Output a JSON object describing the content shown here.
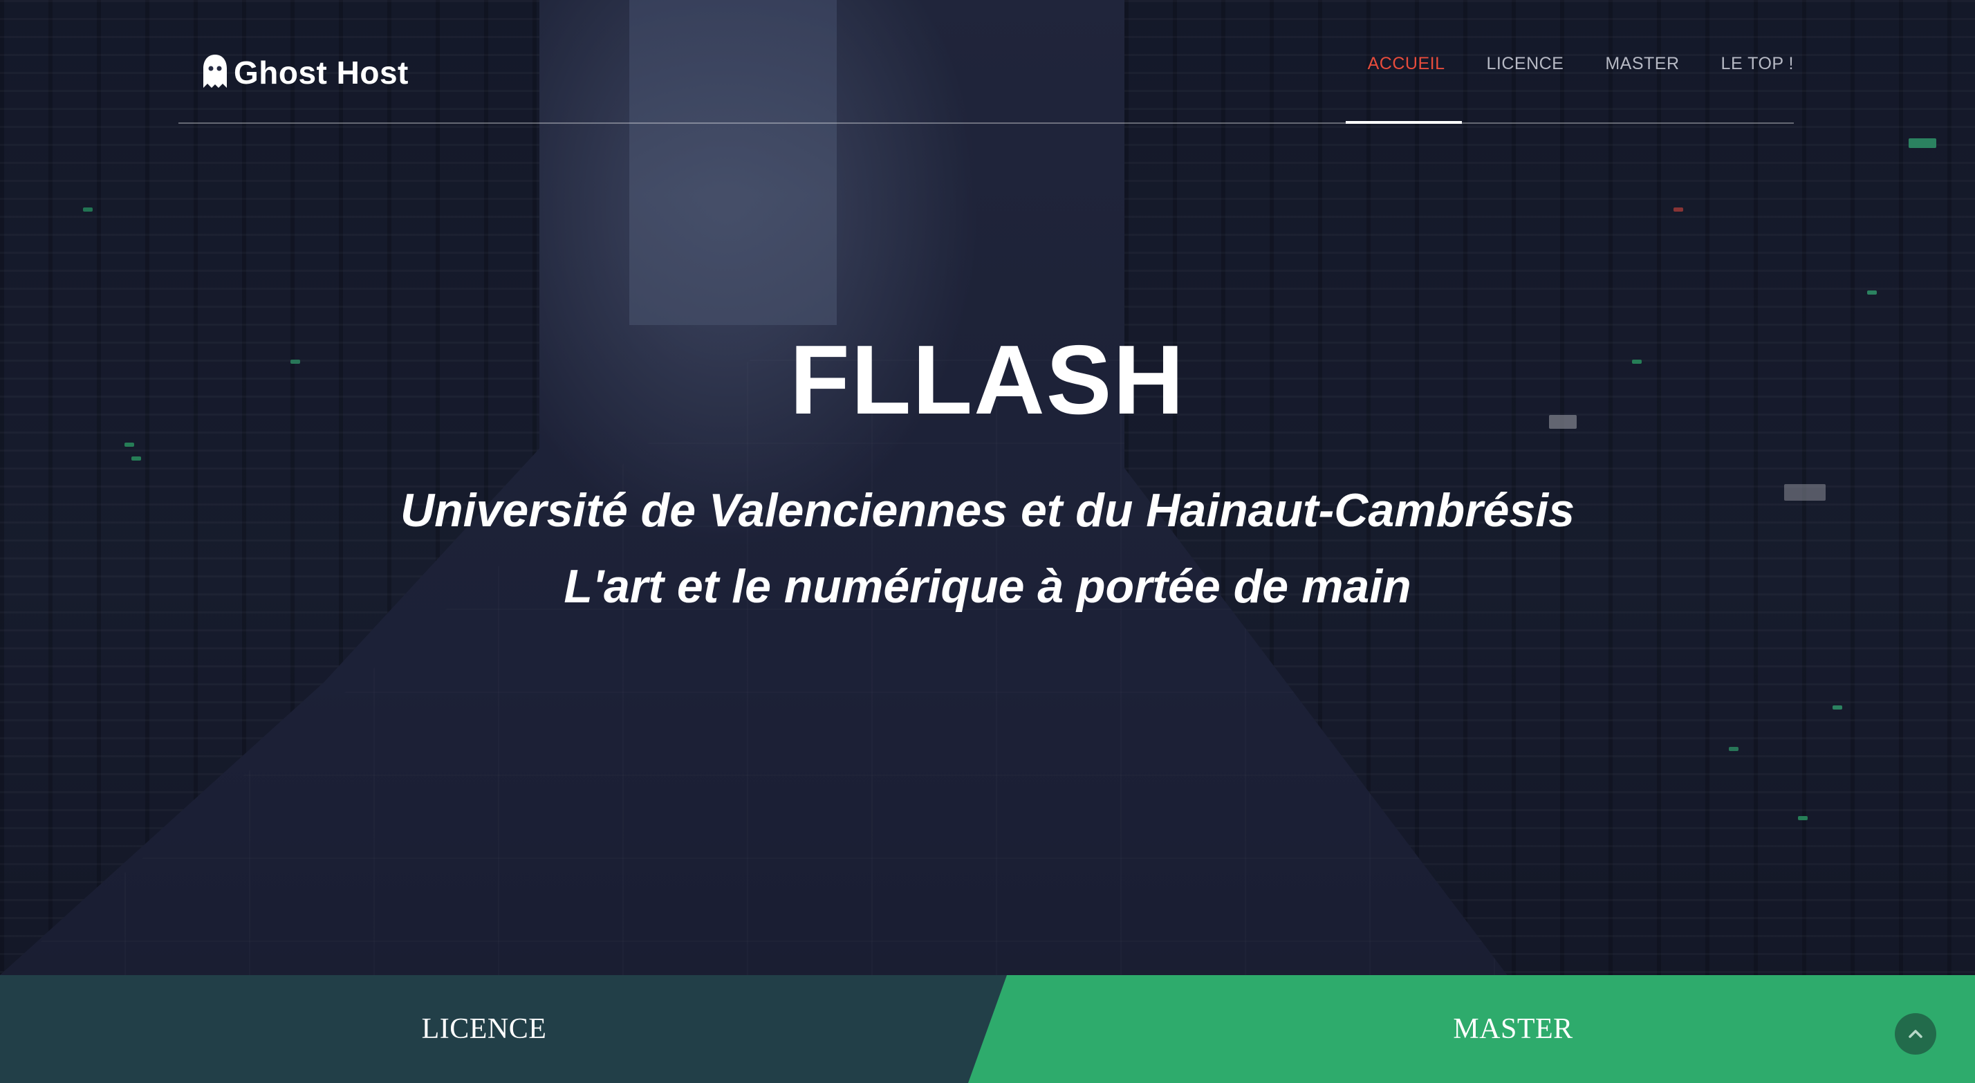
{
  "brand": {
    "name": "Ghost Host",
    "logo_icon": "ghost-icon"
  },
  "nav": {
    "items": [
      {
        "label": "ACCUEIL",
        "active": true
      },
      {
        "label": "LICENCE",
        "active": false
      },
      {
        "label": "MASTER",
        "active": false
      },
      {
        "label": "LE TOP !",
        "active": false
      }
    ]
  },
  "hero": {
    "title": "FLLASH",
    "subtitle_1": "Université de Valenciennes et du Hainaut-Cambrésis",
    "subtitle_2": "L'art et le numérique à portée de main"
  },
  "panels": {
    "licence_label": "LICENCE",
    "master_label": "MASTER"
  },
  "scroll_top": {
    "icon": "chevron-up-icon"
  },
  "colors": {
    "nav_active": "#e74c3c",
    "nav_default": "#b6b9c4",
    "licence_panel": "#223f48",
    "master_panel": "#2eab6c",
    "scroll_top_button": "#226b4b",
    "hero_overlay": "#1d2236"
  }
}
